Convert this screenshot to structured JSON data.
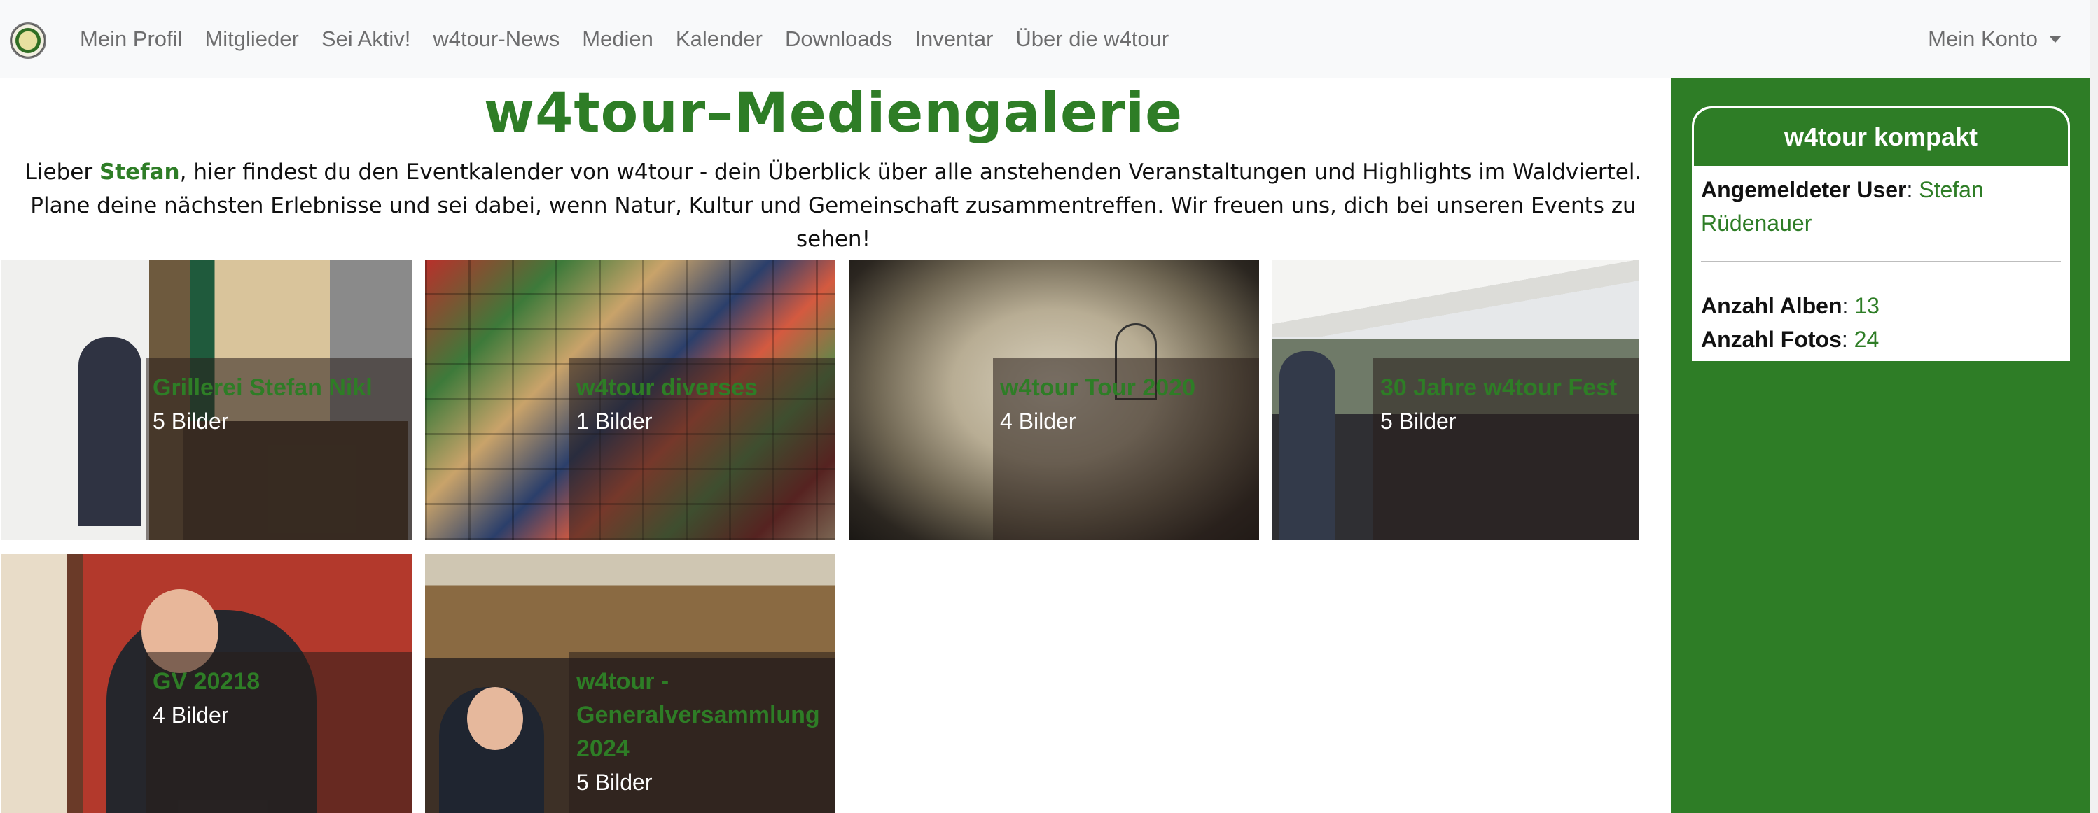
{
  "nav": {
    "logo_icon": "w4tour-logo-icon",
    "items": [
      "Mein Profil",
      "Mitglieder",
      "Sei Aktiv!",
      "w4tour-News",
      "Medien",
      "Kalender",
      "Downloads",
      "Inventar",
      "Über die w4tour"
    ],
    "account": "Mein Konto"
  },
  "main": {
    "title": "w4tour–Mediengalerie",
    "intro_prefix": "Lieber ",
    "intro_name": "Stefan",
    "intro_text": ", hier findest du den Eventkalender von w4tour - dein Überblick über alle anstehenden Veranstaltungen und Highlights im Waldviertel. Plane deine nächsten Erlebnisse und sei dabei, wenn Natur, Kultur und Gemeinschaft zusammentreffen. Wir freuen uns, dich bei unseren Events zu sehen!"
  },
  "albums": [
    {
      "title": "Grillerei Stefan Nikl",
      "count": "5 Bilder"
    },
    {
      "title": "w4tour diverses",
      "count": "1 Bilder"
    },
    {
      "title": "w4tour Tour 2020",
      "count": "4 Bilder"
    },
    {
      "title": "30 Jahre w4tour Fest",
      "count": "5 Bilder"
    },
    {
      "title": "GV 20218",
      "count": "4 Bilder"
    },
    {
      "title": "w4tour - Generalversammlung 2024",
      "count": "5 Bilder"
    }
  ],
  "sidebar": {
    "header": "w4tour kompakt",
    "user_label": "Angemeldeter User",
    "user_value": "Stefan Rüdenauer",
    "albums_label": "Anzahl Alben",
    "albums_value": "13",
    "photos_label": "Anzahl Fotos",
    "photos_value": "24",
    "colon": ": "
  },
  "colors": {
    "accent": "#2e7d26",
    "navbar": "#f8f9fa"
  }
}
